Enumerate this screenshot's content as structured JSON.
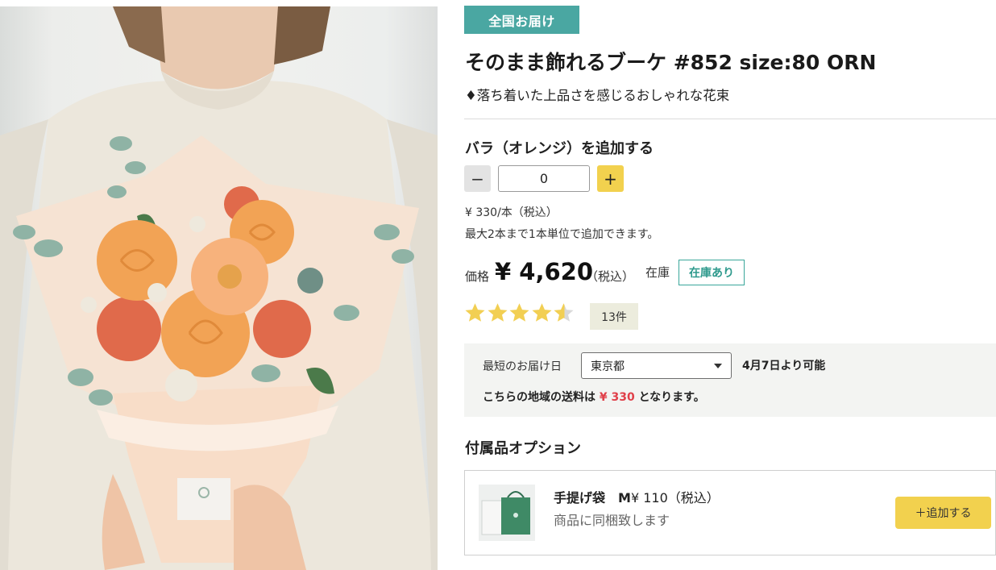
{
  "product": {
    "badge": "全国お届け",
    "title": "そのまま飾れるブーケ #852 size:80 ORN",
    "subtitle": "♦落ち着いた上品さを感じるおしゃれな花束",
    "image_alt": "orange-rose-bouquet-photo"
  },
  "addon": {
    "title": "バラ（オレンジ）を追加する",
    "minus_label": "−",
    "plus_label": "+",
    "quantity": "0",
    "unit_price": "¥ 330/本（税込）",
    "note": "最大2本まで1本単位で追加できます。"
  },
  "price": {
    "label": "価格",
    "value": "¥ 4,620",
    "tax": "（税込）",
    "stock_label": "在庫",
    "stock_status": "在庫あり"
  },
  "rating": {
    "stars": 4.5,
    "count": "13件",
    "star_color": "#f2cf53"
  },
  "delivery": {
    "label": "最短のお届け日",
    "region": "東京都",
    "date": "4月7日より可能",
    "fee_prefix": "こちらの地域の送料は",
    "fee": "¥ 330",
    "fee_suffix": "となります。"
  },
  "options": {
    "title": "付属品オプション",
    "items": [
      {
        "name": "手提げ袋　M",
        "price": "¥ 110（税込）",
        "description": "商品に同梱致します",
        "add_label": "＋追加する"
      }
    ]
  },
  "colors": {
    "badge": "#4aa7a2",
    "accent_yellow": "#f2d14e",
    "stock_green": "#2f9a8d",
    "fee_red": "#e0404a"
  }
}
